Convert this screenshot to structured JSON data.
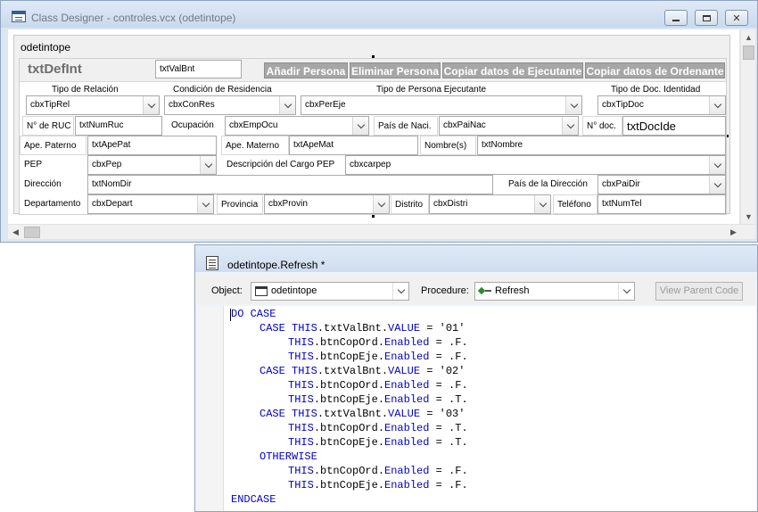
{
  "class_designer": {
    "title": "Class Designer - controles.vcx (odetintope)",
    "form_caption": "odetintope",
    "header_label": "txtDefInt",
    "val_bnt": "txtValBnt",
    "buttons": {
      "add_person": "Añadir Persona",
      "remove_person": "Eliminar Persona",
      "copy_executor": "Copiar datos de Ejecutante",
      "copy_orderer": "Copiar datos de Ordenante"
    },
    "labels": {
      "tipo_relacion": "Tipo de Relación",
      "condicion_residencia": "Condición de Residencia",
      "tipo_persona": "Tipo de Persona Ejecutante",
      "tipo_doc": "Tipo de Doc. Identidad",
      "num_ruc": "N° de RUC",
      "ocupacion": "Ocupación",
      "pais_naci": "País de Naci.",
      "num_doc": "N° doc.",
      "ape_paterno": "Ape. Paterno",
      "ape_materno": "Ape. Materno",
      "nombres": "Nombre(s)",
      "pep": "PEP",
      "desc_cargo": "Descripción del Cargo PEP",
      "direccion": "Dirección",
      "pais_direccion": "País de la Dirección",
      "departamento": "Departamento",
      "provincia": "Provincia",
      "distrito": "Distrito",
      "telefono": "Teléfono"
    },
    "fields": {
      "cbx_tip_rel": "cbxTipRel",
      "cbx_con_res": "cbxConRes",
      "cbx_per_eje": "cbxPerEje",
      "cbx_tip_doc": "cbxTipDoc",
      "txt_num_ruc": "txtNumRuc",
      "cbx_emp_ocu": "cbxEmpOcu",
      "cbx_pai_nac": "cbxPaiNac",
      "txt_doc_ide": "txtDocIde",
      "txt_ape_pat": "txtApePat",
      "txt_ape_mat": "txtApeMat",
      "txt_nombre": "txtNombre",
      "cbx_pep": "cbxPep",
      "cbx_carpep": "cbxcarpep",
      "txt_nom_dir": "txtNomDir",
      "cbx_pai_dir": "cbxPaiDir",
      "cbx_depart": "cbxDepart",
      "cbx_provin": "cbxProvin",
      "cbx_distri": "cbxDistri",
      "txt_num_tel": "txtNumTel"
    }
  },
  "code_editor": {
    "title": "odetintope.Refresh *",
    "object_label": "Object:",
    "object_value": "odetintope",
    "procedure_label": "Procedure:",
    "procedure_value": "Refresh",
    "view_parent_label": "View Parent Code",
    "lines": [
      {
        "kw": "DO CASE",
        "rest": ""
      },
      {
        "kw": "CASE THIS",
        "rest": ".txtValBnt.",
        "kw2": "VALUE",
        "rest2": " = '01'"
      },
      {
        "kw": "THIS",
        "rest": ".btnCopOrd.",
        "kw2": "Enabled",
        "rest2": " = .F."
      },
      {
        "kw": "THIS",
        "rest": ".btnCopEje.",
        "kw2": "Enabled",
        "rest2": " = .F."
      },
      {
        "kw": "CASE THIS",
        "rest": ".txtValBnt.",
        "kw2": "VALUE",
        "rest2": " = '02'"
      },
      {
        "kw": "THIS",
        "rest": ".btnCopOrd.",
        "kw2": "Enabled",
        "rest2": " = .F."
      },
      {
        "kw": "THIS",
        "rest": ".btnCopEje.",
        "kw2": "Enabled",
        "rest2": " = .T."
      },
      {
        "kw": "CASE THIS",
        "rest": ".txtValBnt.",
        "kw2": "VALUE",
        "rest2": " = '03'"
      },
      {
        "kw": "THIS",
        "rest": ".btnCopOrd.",
        "kw2": "Enabled",
        "rest2": " = .T."
      },
      {
        "kw": "THIS",
        "rest": ".btnCopEje.",
        "kw2": "Enabled",
        "rest2": " = .T."
      },
      {
        "kw": "OTHERWISE",
        "rest": ""
      },
      {
        "kw": "THIS",
        "rest": ".btnCopOrd.",
        "kw2": "Enabled",
        "rest2": " = .F."
      },
      {
        "kw": "THIS",
        "rest": ".btnCopEje.",
        "kw2": "Enabled",
        "rest2": " = .F."
      },
      {
        "kw": "ENDCASE",
        "rest": ""
      }
    ]
  },
  "colors": {
    "keyword": "#0000cc",
    "button_bg": "#a6a6a6"
  }
}
